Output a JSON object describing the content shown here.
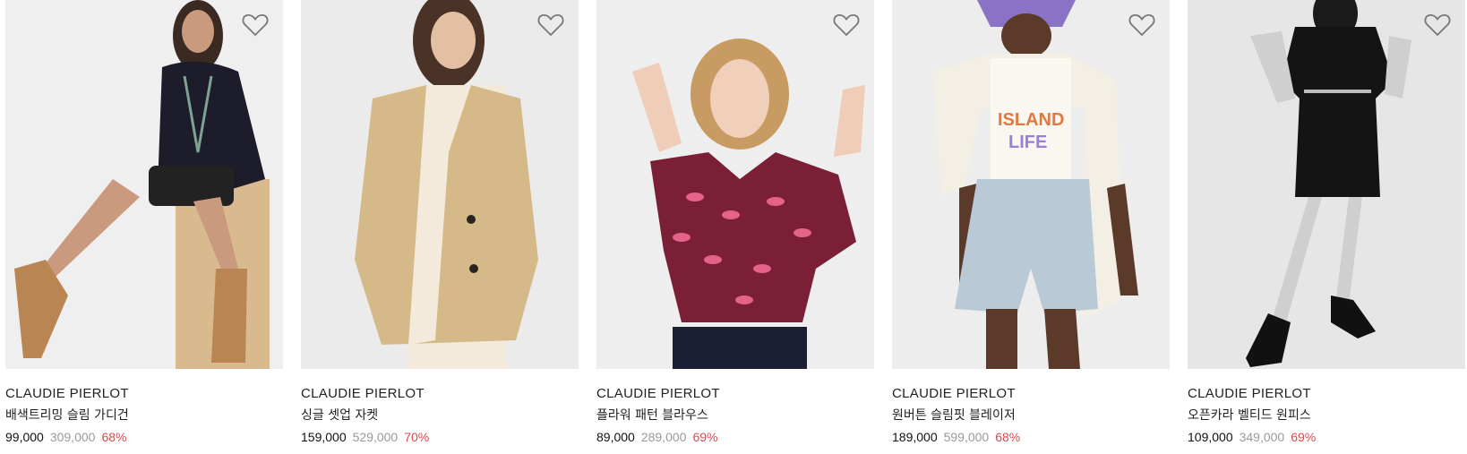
{
  "products": [
    {
      "brand": "CLAUDIE PIERLOT",
      "name": "배색트리밍 슬림 가디건",
      "price": "99,000",
      "original_price": "309,000",
      "discount": "68%"
    },
    {
      "brand": "CLAUDIE PIERLOT",
      "name": "싱글 셋업 자켓",
      "price": "159,000",
      "original_price": "529,000",
      "discount": "70%"
    },
    {
      "brand": "CLAUDIE PIERLOT",
      "name": "플라워 패턴 블라우스",
      "price": "89,000",
      "original_price": "289,000",
      "discount": "69%"
    },
    {
      "brand": "CLAUDIE PIERLOT",
      "name": "원버튼 슬림핏 블레이저",
      "price": "189,000",
      "original_price": "599,000",
      "discount": "68%"
    },
    {
      "brand": "CLAUDIE PIERLOT",
      "name": "오픈카라 벨티드 원피스",
      "price": "109,000",
      "original_price": "349,000",
      "discount": "69%"
    }
  ],
  "icons": {
    "wishlist": "heart-outline-icon"
  },
  "colors": {
    "discount": "#e0474d",
    "original_price": "#9a9a9a",
    "text": "#222222"
  }
}
